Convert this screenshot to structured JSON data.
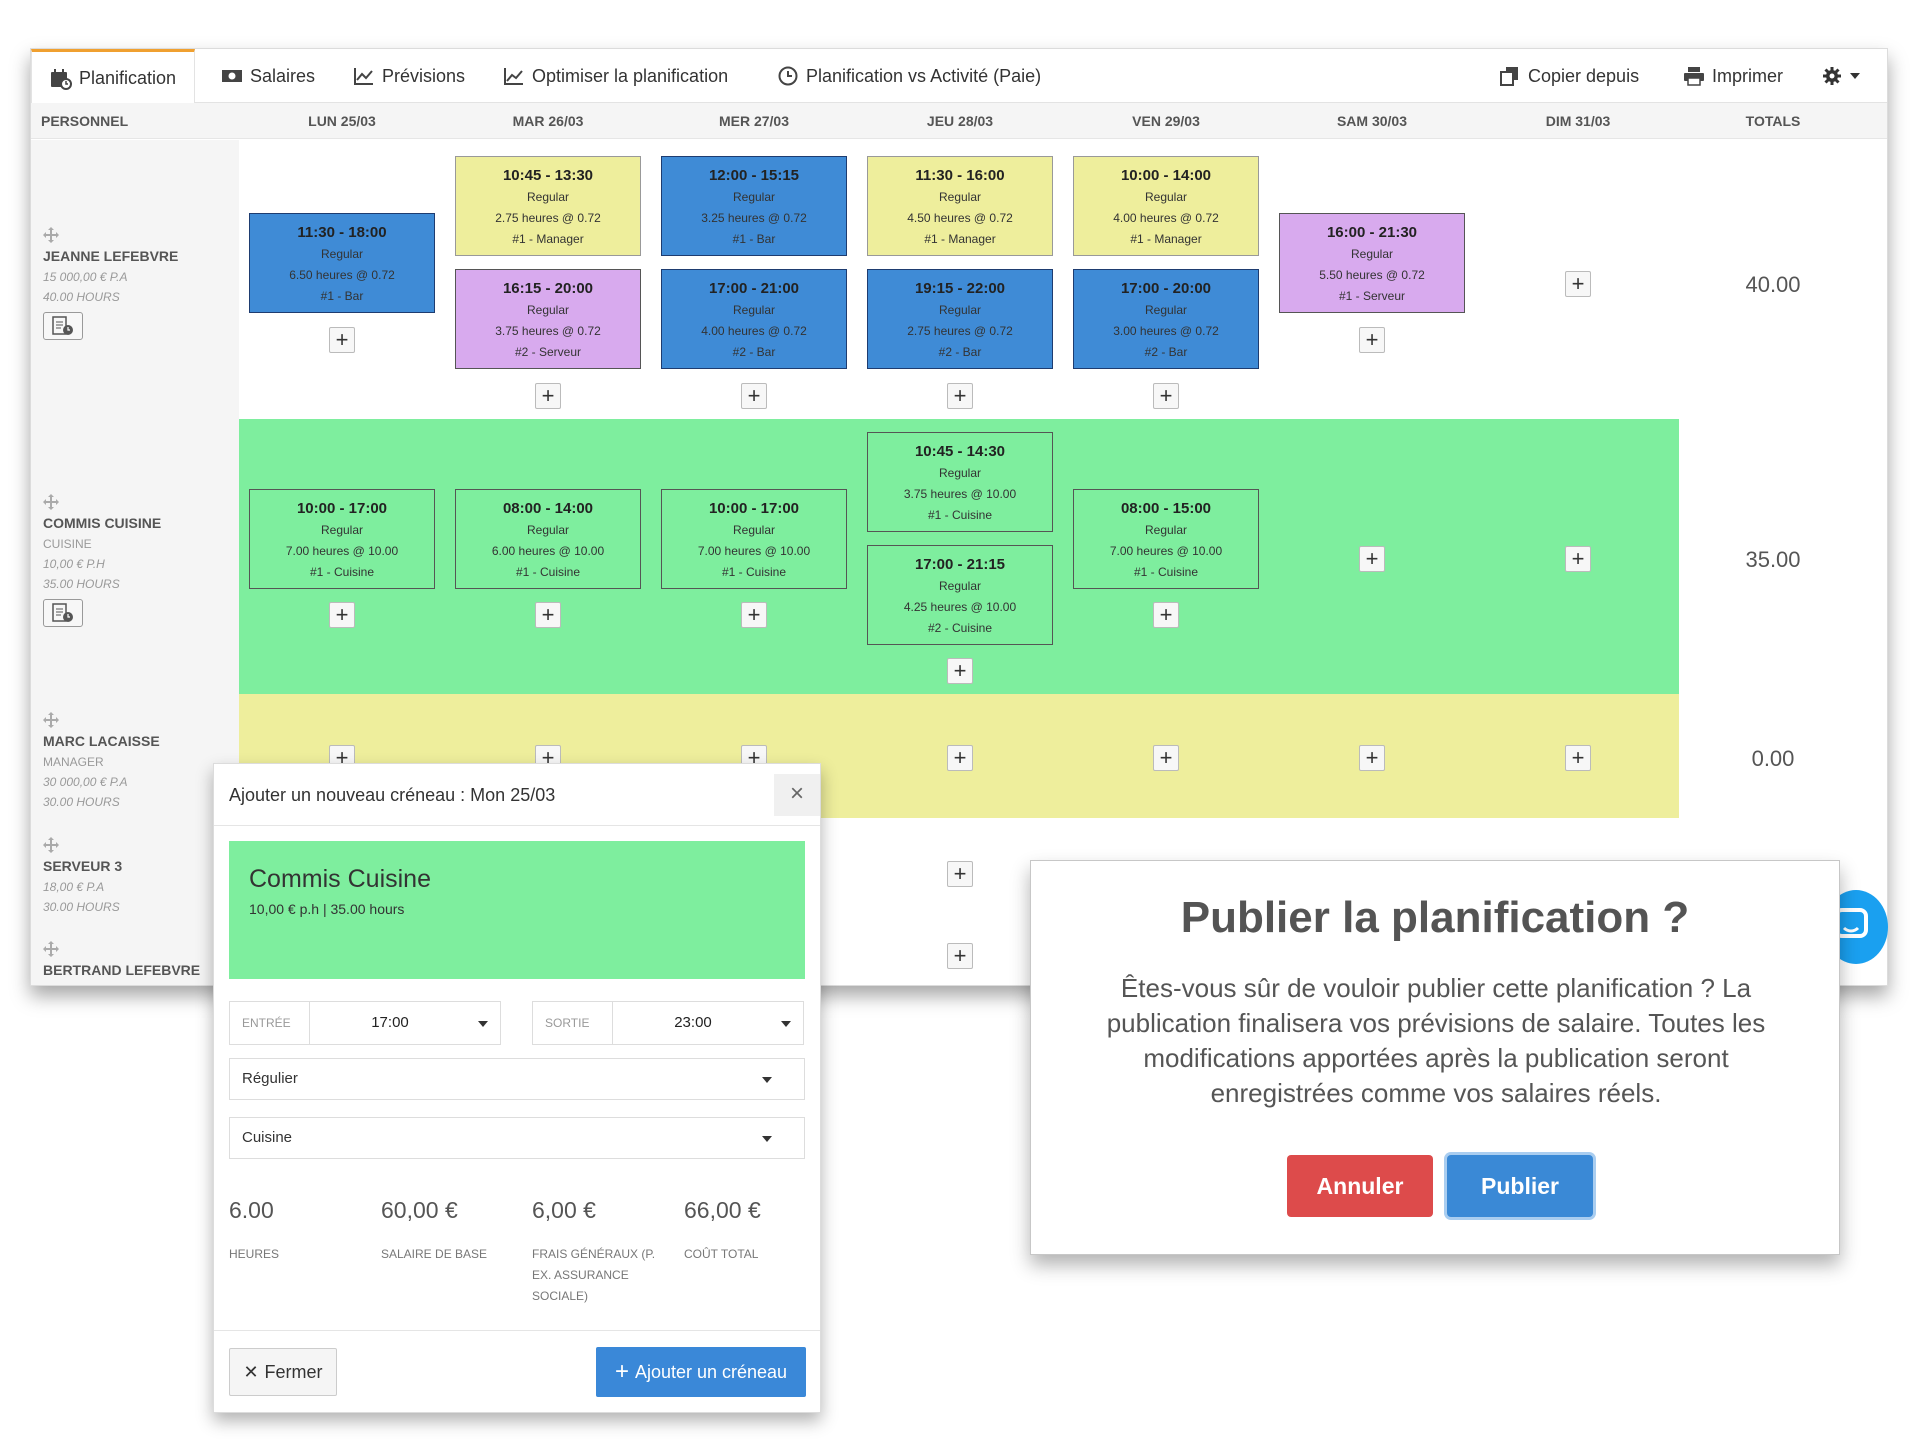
{
  "tabs": [
    {
      "label": "Planification",
      "icon": "calendar-clock-icon",
      "active": true
    },
    {
      "label": "Salaires",
      "icon": "money-icon"
    },
    {
      "label": "Prévisions",
      "icon": "line-chart-icon"
    },
    {
      "label": "Optimiser la planification",
      "icon": "area-chart-icon"
    },
    {
      "label": "Planification vs Activité (Paie)",
      "icon": "clock-icon"
    }
  ],
  "actions": {
    "copy_label": "Copier depuis",
    "print_label": "Imprimer"
  },
  "columns": {
    "staff": "PERSONNEL",
    "days": [
      "LUN 25/03",
      "MAR 26/03",
      "MER 27/03",
      "JEU 28/03",
      "VEN 29/03",
      "SAM 30/03",
      "DIM 31/03"
    ],
    "totals": "TOTALS"
  },
  "staff": [
    {
      "name": "JEANNE LEFEBVRE",
      "role": "",
      "pay": "15 000,00 € P.A",
      "hours": "40.00 HOURS",
      "total": "40.00"
    },
    {
      "name": "COMMIS CUISINE",
      "role": "CUISINE",
      "pay": "10,00 € P.H",
      "hours": "35.00 HOURS",
      "total": "35.00"
    },
    {
      "name": "MARC LACAISSE",
      "role": "MANAGER",
      "pay": "30 000,00 € P.A",
      "hours": "30.00 HOURS",
      "total": "0.00"
    },
    {
      "name": "SERVEUR 3",
      "role": "",
      "pay": "18,00 € P.A",
      "hours": "30.00 HOURS"
    },
    {
      "name": "BERTRAND LEFEBVRE"
    }
  ],
  "shifts": {
    "r1": [
      {
        "time": "11:30 - 18:00",
        "type": "Regular",
        "detail": "6.50 heures @ 0.72",
        "pos": "#1 - Bar"
      },
      {
        "time": "10:45 - 13:30",
        "type": "Regular",
        "detail": "2.75 heures @ 0.72",
        "pos": "#1 - Manager"
      },
      {
        "time": "16:15 - 20:00",
        "type": "Regular",
        "detail": "3.75 heures @ 0.72",
        "pos": "#2 - Serveur"
      },
      {
        "time": "12:00 - 15:15",
        "type": "Regular",
        "detail": "3.25 heures @ 0.72",
        "pos": "#1 - Bar"
      },
      {
        "time": "17:00 - 21:00",
        "type": "Regular",
        "detail": "4.00 heures @ 0.72",
        "pos": "#2 - Bar"
      },
      {
        "time": "11:30 - 16:00",
        "type": "Regular",
        "detail": "4.50 heures @ 0.72",
        "pos": "#1 - Manager"
      },
      {
        "time": "19:15 - 22:00",
        "type": "Regular",
        "detail": "2.75 heures @ 0.72",
        "pos": "#2 - Bar"
      },
      {
        "time": "10:00 - 14:00",
        "type": "Regular",
        "detail": "4.00 heures @ 0.72",
        "pos": "#1 - Manager"
      },
      {
        "time": "17:00 - 20:00",
        "type": "Regular",
        "detail": "3.00 heures @ 0.72",
        "pos": "#2 - Bar"
      },
      {
        "time": "16:00 - 21:30",
        "type": "Regular",
        "detail": "5.50 heures @ 0.72",
        "pos": "#1 - Serveur"
      }
    ],
    "r2": [
      {
        "time": "10:00 - 17:00",
        "type": "Regular",
        "detail": "7.00 heures @ 10.00",
        "pos": "#1 - Cuisine"
      },
      {
        "time": "08:00 - 14:00",
        "type": "Regular",
        "detail": "6.00 heures @ 10.00",
        "pos": "#1 - Cuisine"
      },
      {
        "time": "10:00 - 17:00",
        "type": "Regular",
        "detail": "7.00 heures @ 10.00",
        "pos": "#1 - Cuisine"
      },
      {
        "time": "10:45 - 14:30",
        "type": "Regular",
        "detail": "3.75 heures @ 10.00",
        "pos": "#1 - Cuisine"
      },
      {
        "time": "17:00 - 21:15",
        "type": "Regular",
        "detail": "4.25 heures @ 10.00",
        "pos": "#2 - Cuisine"
      },
      {
        "time": "08:00 - 15:00",
        "type": "Regular",
        "detail": "7.00 heures @ 10.00",
        "pos": "#1 - Cuisine"
      }
    ]
  },
  "add_shift_modal": {
    "title": "Ajouter un nouveau créneau : Mon 25/03",
    "employee_name": "Commis Cuisine",
    "employee_rate": "10,00 € p.h  |  35.00 hours",
    "start_label": "ENTRÉE",
    "start_value": "17:00",
    "end_label": "SORTIE",
    "end_value": "23:00",
    "shift_type": "Régulier",
    "position": "Cuisine",
    "stats": [
      {
        "value": "6.00",
        "label": "HEURES"
      },
      {
        "value": "60,00 €",
        "label": "SALAIRE DE BASE"
      },
      {
        "value": "6,00 €",
        "label": "FRAIS GÉNÉRAUX (P. EX. ASSURANCE SOCIALE)"
      },
      {
        "value": "66,00 €",
        "label": "COÛT TOTAL"
      }
    ],
    "close_label": "Fermer",
    "add_label": "Ajouter un créneau"
  },
  "publish_dialog": {
    "title": "Publier la planification ?",
    "message": "Êtes-vous sûr de vouloir publier cette planification ? La publication finalisera vos prévisions de salaire. Toutes les modifications apportées après la publication seront enregistrées comme vos salaires réels.",
    "cancel_label": "Annuler",
    "publish_label": "Publier"
  },
  "colors": {
    "shift_blue": "#3f8bd6",
    "shift_yellow": "#eeee9c",
    "shift_purple": "#d8aaee",
    "row_green": "#7eee9e",
    "row_yellow": "#eeee9c",
    "tab_accent": "#f0a030",
    "danger": "#dd4b4b",
    "primary": "#3a89d6"
  }
}
